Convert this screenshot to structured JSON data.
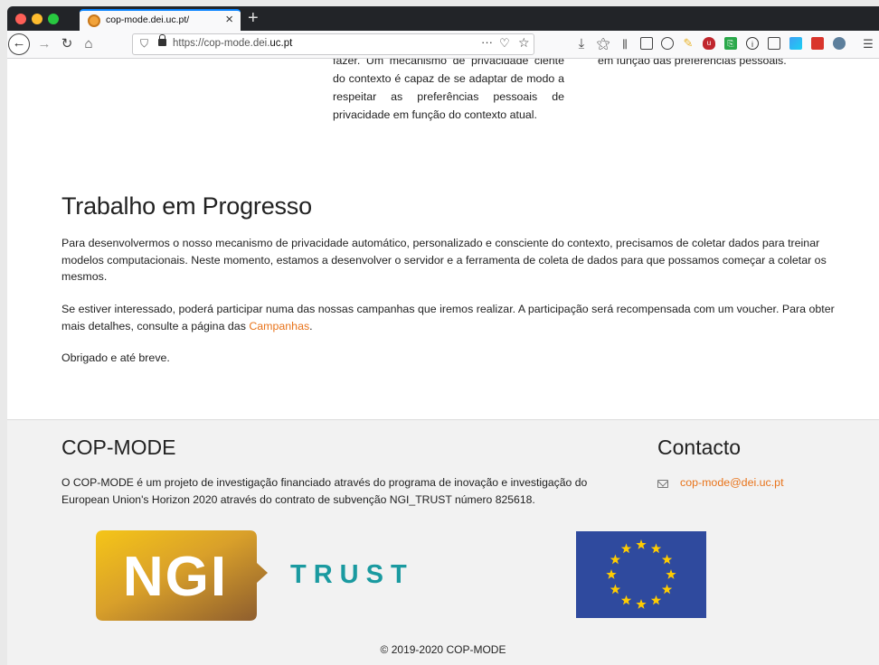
{
  "browser": {
    "tab_title": "cop-mode.dei.uc.pt/",
    "url_prefix": "https://cop-mode.dei.",
    "url_domain": "uc.pt",
    "toolbar_icons": [
      "back-icon",
      "forward-icon",
      "reload-icon",
      "home-icon",
      "download-icon",
      "bookmark-manager-icon",
      "library-icon",
      "sidebar-icon",
      "account-icon",
      "extension-icons"
    ]
  },
  "top_fragment": {
    "middle_column": "fazer. Um mecanismo de privacidade ciente do contexto é capaz de se adaptar de modo a respeitar as preferências pessoais de privacidade em função do contexto atual.",
    "right_column": "em função das preferências pessoais."
  },
  "wip": {
    "heading": "Trabalho em Progresso",
    "p1": "Para desenvolvermos o nosso mecanismo de privacidade automático, personalizado e consciente do contexto, precisamos de coletar dados para treinar modelos computacionais. Neste momento, estamos a desenvolver o servidor e a ferramenta de coleta de dados para que possamos começar a coletar os mesmos.",
    "p2_text": "Se estiver interessado, poderá participar numa das nossas campanhas que iremos realizar. A participação será recompensada com um voucher. Para obter mais detalhes, consulte a página das ",
    "p2_link": "Campanhas",
    "p2_end": ".",
    "p3": "Obrigado e até breve."
  },
  "footer": {
    "title": "COP-MODE",
    "description": "O COP-MODE é um projeto de investigação financiado através do programa de inovação e investigação do European Union's Horizon 2020 através do contrato de subvenção NGI_TRUST número 825618.",
    "contact_title": "Contacto",
    "contact_email": "cop-mode@dei.uc.pt",
    "logo_ngi_text": "NGI",
    "logo_trust_text": "TRUST",
    "copyright": "© 2019-2020 COP-MODE"
  },
  "colors": {
    "link": "#e8731a",
    "ngi_teal": "#1a9aa0",
    "eu_blue": "#2f4a9e",
    "eu_star": "#ffcc00"
  }
}
